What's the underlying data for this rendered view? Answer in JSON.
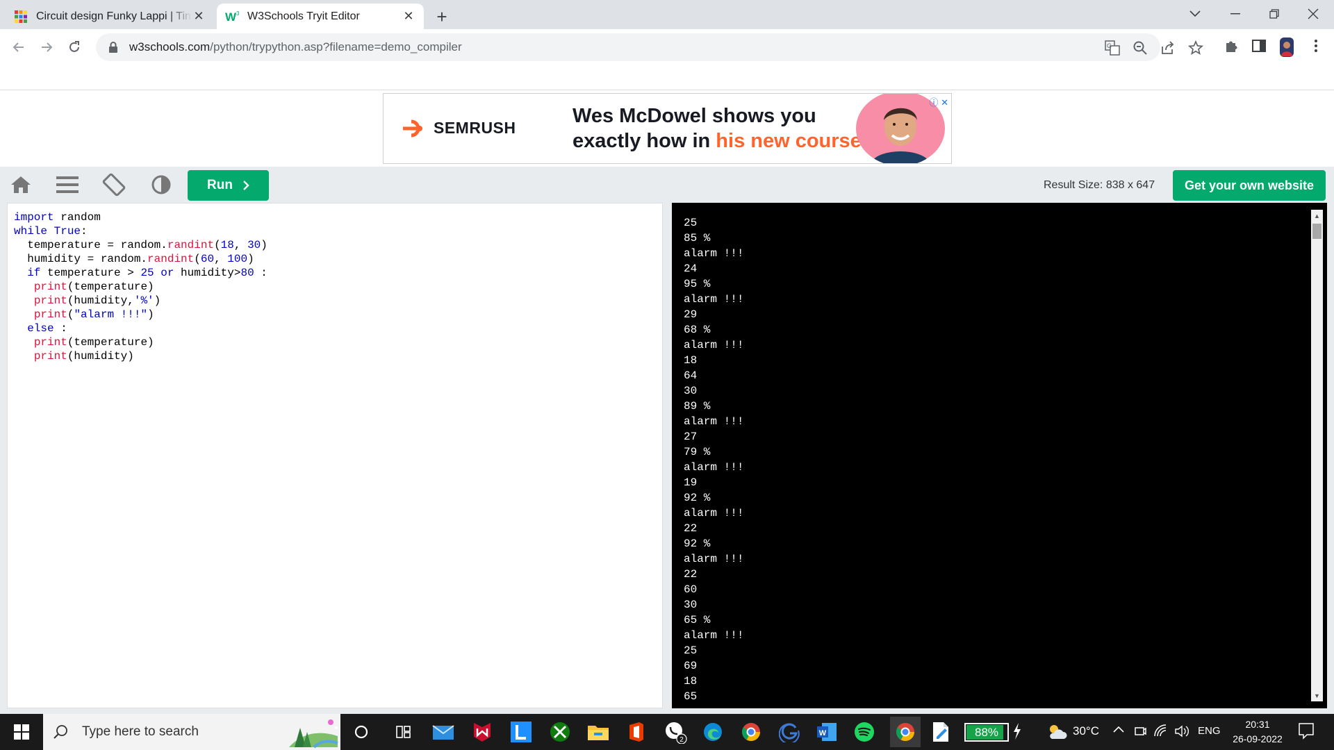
{
  "browser": {
    "tabs": [
      {
        "title": "Circuit design Funky Lappi | Tinkercad"
      },
      {
        "title": "W3Schools Tryit Editor"
      }
    ],
    "url_host": "w3schools.com",
    "url_path": "/python/trypython.asp?filename=demo_compiler"
  },
  "ad": {
    "brand": "SEMRUSH",
    "headline_line1": "Wes McDowel shows you",
    "headline_line2_plain": "exactly how in ",
    "headline_line2_highlight": "his new course",
    "colors": {
      "accent": "#ff642d",
      "portrait_bg": "#f78da7"
    }
  },
  "editor": {
    "run_label": "Run",
    "result_size": "Result Size: 838 x 647",
    "get_website_label": "Get your own website",
    "colors": {
      "button": "#04aa6d"
    }
  },
  "code": {
    "lines": [
      "import random",
      "while True:",
      "  temperature = random.randint(18, 30)",
      "  humidity = random.randint(60, 100)",
      "  if temperature > 25 or humidity>80 :",
      "   print(temperature)",
      "   print(humidity,'%')",
      "   print(\"alarm !!!\")",
      "  else :",
      "   print(temperature)",
      "   print(humidity)"
    ]
  },
  "output": {
    "lines": [
      "25",
      "85 %",
      "alarm !!!",
      "24",
      "95 %",
      "alarm !!!",
      "29",
      "68 %",
      "alarm !!!",
      "18",
      "64",
      "30",
      "89 %",
      "alarm !!!",
      "27",
      "79 %",
      "alarm !!!",
      "19",
      "92 %",
      "alarm !!!",
      "22",
      "92 %",
      "alarm !!!",
      "22",
      "60",
      "30",
      "65 %",
      "alarm !!!",
      "25",
      "69",
      "18",
      "65"
    ]
  },
  "taskbar": {
    "search_placeholder": "Type here to search",
    "whatsapp_badge": "2",
    "battery": "88%",
    "battery_level": 0.88,
    "temperature": "30°C",
    "language": "ENG",
    "time": "20:31",
    "date": "26-09-2022"
  }
}
